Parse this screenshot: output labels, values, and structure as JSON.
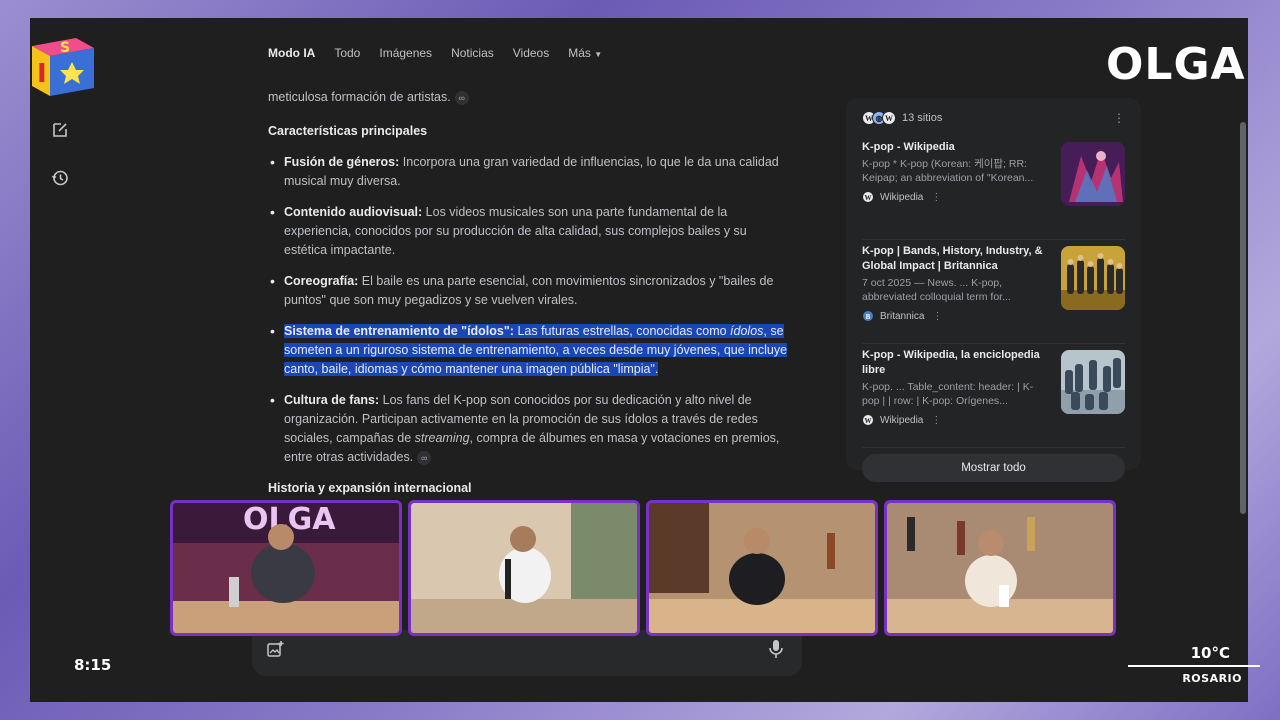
{
  "tabs": [
    "Modo IA",
    "Todo",
    "Imágenes",
    "Noticias",
    "Videos",
    "Más"
  ],
  "content": {
    "intro_tail": "meticulosa formación de artistas.",
    "section_title": "Características principales",
    "bullets": [
      {
        "title": "Fusión de géneros:",
        "text": " Incorpora una gran variedad de influencias, lo que le da una calidad musical muy diversa."
      },
      {
        "title": "Contenido audiovisual:",
        "text": " Los videos musicales son una parte fundamental de la experiencia, conocidos por su producción de alta calidad, sus complejos bailes y su estética impactante."
      },
      {
        "title": "Coreografía:",
        "text": " El baile es una parte esencial, con movimientos sincronizados y \"bailes de puntos\" que son muy pegadizos y se vuelven virales."
      },
      {
        "title": "Sistema de entrenamiento de \"ídolos\":",
        "text_a": " Las futuras estrellas, conocidas como ",
        "text_em": "ídolos",
        "text_b": ", se someten a un riguroso sistema de entrenamiento, a veces desde muy jóvenes, que incluye canto, baile, idiomas y cómo mantener una imagen pública \"limpia\"."
      },
      {
        "title": "Cultura de fans:",
        "text_a": " Los fans del K-pop son conocidos por su dedicación y alto nivel de organización. Participan activamente en la promoción de sus ídolos a través de redes sociales, campañas de ",
        "text_em": "streaming",
        "text_b": ", compra de álbumes en masa y votaciones en premios, entre otras actividades."
      }
    ],
    "section_title_2": "Historia y expansión internacional"
  },
  "sources": {
    "count_label": "13 sitios",
    "items": [
      {
        "title": "K-pop - Wikipedia",
        "snippet": "K-pop * K-pop (Korean: 케이팝; RR: Keipap; an abbreviation of \"Korean...",
        "site": "Wikipedia",
        "fav": "W"
      },
      {
        "title": "K-pop | Bands, History, Industry, & Global Impact | Britannica",
        "snippet": "7 oct 2025 — News. ... K-pop, abbreviated colloquial term for...",
        "site": "Britannica",
        "fav": "B"
      },
      {
        "title": "K-pop - Wikipedia, la enciclopedia libre",
        "snippet": "K-pop. ... Table_content: header: | K-pop | | row: | K-pop: Orígenes...",
        "site": "Wikipedia",
        "fav": "W"
      }
    ],
    "show_all": "Mostrar todo"
  },
  "overlay": {
    "brand": "OLGA",
    "time": "8:15",
    "temperature": "10°C",
    "city": "ROSARIO"
  },
  "colors": {
    "accent_highlight": "#1a47b8",
    "cam_border": "#7a2fc7"
  }
}
